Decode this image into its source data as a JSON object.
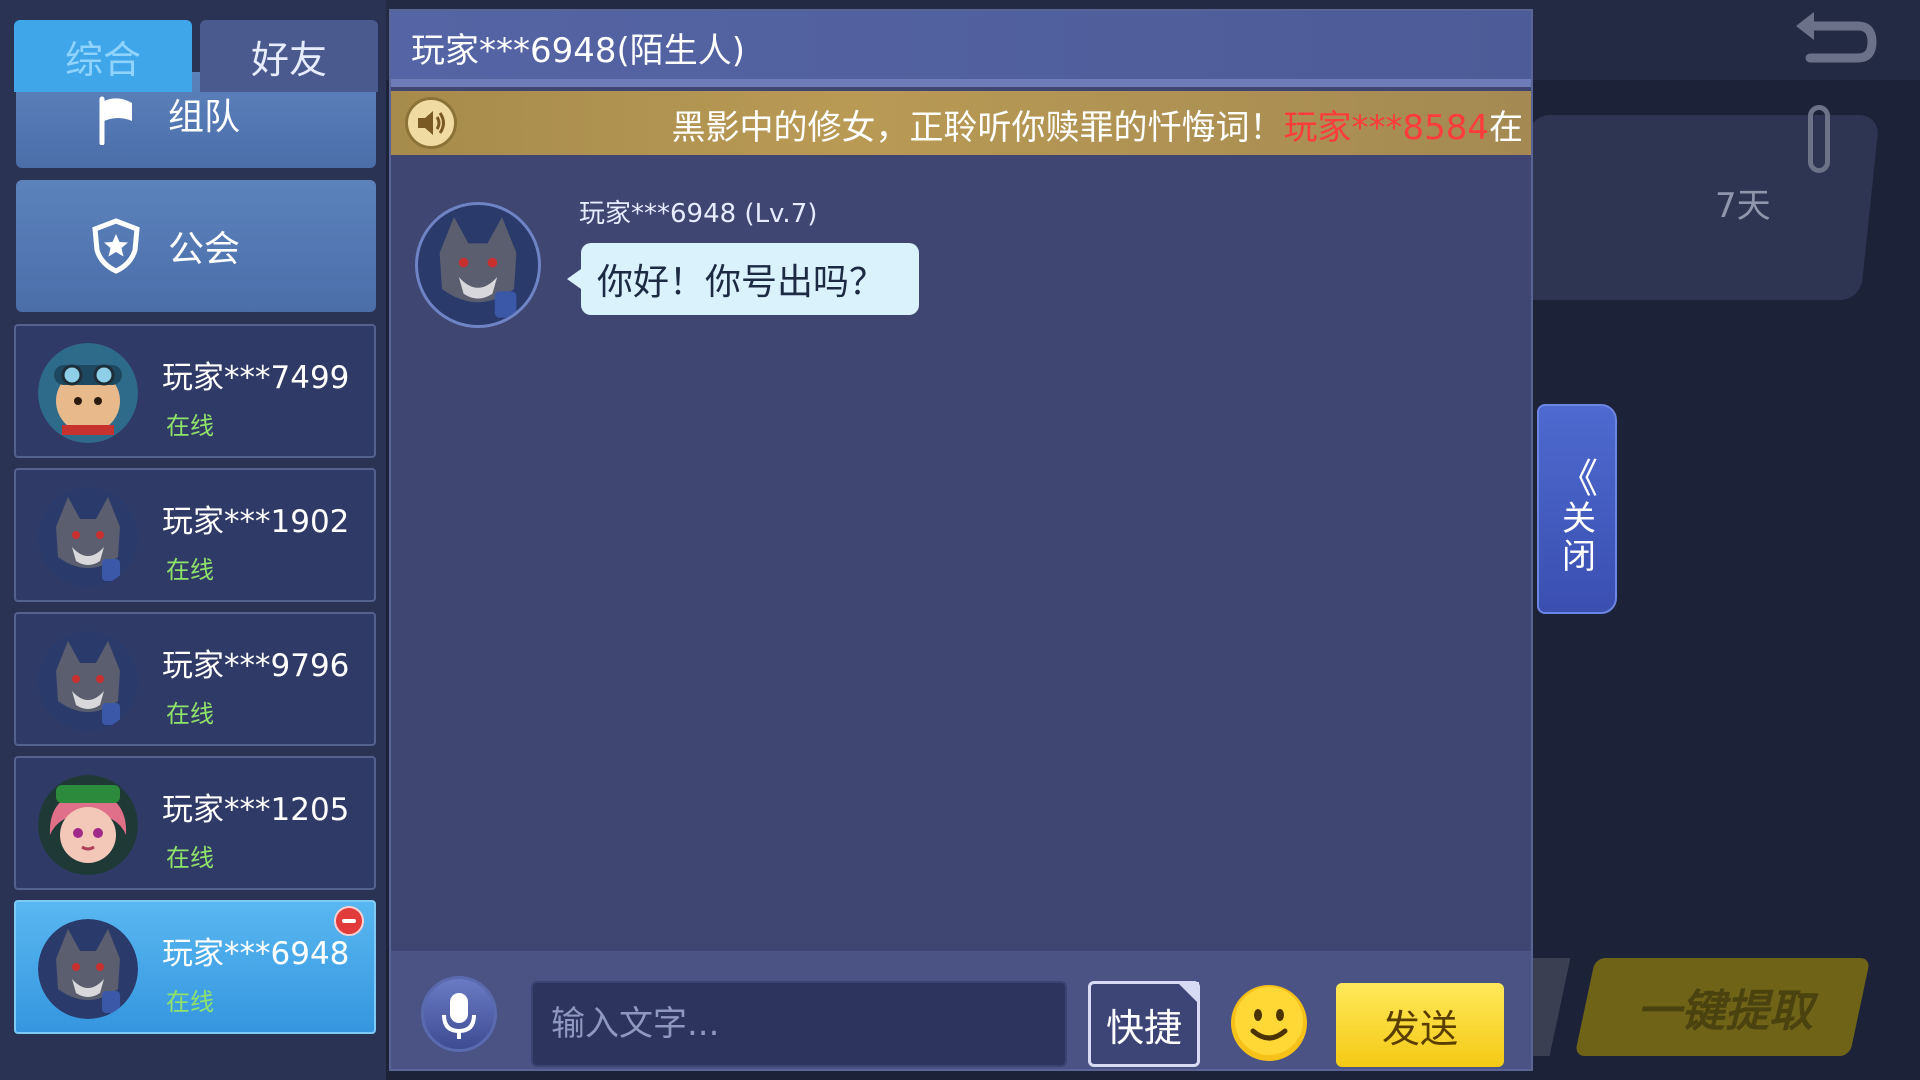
{
  "tabs": {
    "general": "综合",
    "friends": "好友"
  },
  "categories": {
    "team_label": "组队",
    "guild_label": "公会"
  },
  "contacts": [
    {
      "name": "玩家***7499",
      "status": "在线"
    },
    {
      "name": "玩家***1902",
      "status": "在线"
    },
    {
      "name": "玩家***9796",
      "status": "在线"
    },
    {
      "name": "玩家***1205",
      "status": "在线"
    },
    {
      "name": "玩家***6948",
      "status": "在线",
      "active": true
    }
  ],
  "chat": {
    "title": "玩家***6948(陌生人)",
    "announcement": {
      "text": "黑影中的修女，正聆听你赎罪的忏悔词！",
      "player": "玩家***8584",
      "trailing": "在"
    },
    "message": {
      "sender": "玩家***6948 (Lv.7)",
      "text": "你好！你号出吗？"
    },
    "input_placeholder": "输入文字...",
    "quick_label": "快捷",
    "send_label": "发送"
  },
  "close_tab": {
    "chevron": "《",
    "label": "关闭"
  },
  "background": {
    "mail_days": "7天",
    "claim_all_label": "一键提取"
  },
  "icons": {
    "back": "back-arrow-icon",
    "flag": "flag-icon",
    "shield": "shield-icon",
    "speaker": "speaker-icon",
    "mic": "microphone-icon",
    "emoji": "smiley-icon",
    "remove": "remove-icon",
    "paperclip": "paperclip-icon"
  },
  "colors": {
    "active_tab": "#3fa6ea",
    "online_status": "#8fe36a",
    "send_button": "#f4c915",
    "announce_player": "#ff3b3b"
  }
}
